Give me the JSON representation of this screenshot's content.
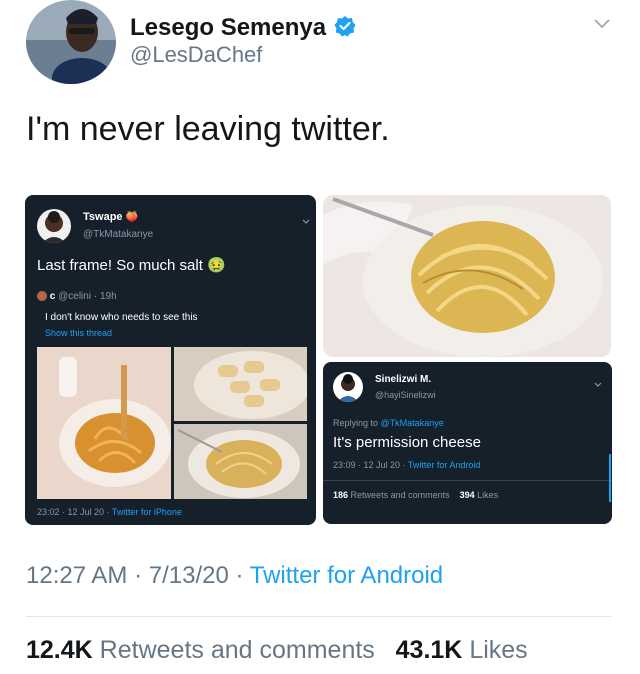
{
  "header": {
    "name": "Lesego Semenya",
    "handle": "@LesDaChef"
  },
  "tweet": {
    "text": "I'm never leaving twitter.",
    "time": "12:27 AM",
    "date": "7/13/20",
    "source": "Twitter for Android",
    "retweets": "12.4K",
    "retweets_label": "Retweets and comments",
    "likes": "43.1K",
    "likes_label": "Likes"
  },
  "quoted_left": {
    "name": "Tswape",
    "name_emoji": "🍑",
    "handle": "@TkMatakanye",
    "text": "Last frame! So much salt",
    "text_emoji": "🤢",
    "inner_name": "c",
    "inner_handle": "@celini",
    "inner_sep": "·",
    "inner_time": "19h",
    "inner_text": "I don't know who needs to see this",
    "show_thread": "Show this thread",
    "footer_time": "23:02 · 12 Jul 20 ·",
    "footer_source": "Twitter for iPhone"
  },
  "quoted_right": {
    "name": "Sinelizwi M.",
    "handle": "@hayiSinelizwi",
    "replying_prefix": "Replying to",
    "replying_to": "@TkMatakanye",
    "text": "It's permission cheese",
    "time": "23:09 · 12 Jul 20 ·",
    "source": "Twitter for Android",
    "retweets": "186",
    "retweets_label": "Retweets and comments",
    "likes": "394",
    "likes_label": "Likes"
  },
  "colors": {
    "link": "#1da1f2",
    "dark_bg": "#15202b",
    "verified": "#1da1f2"
  },
  "icons": [
    "verified-badge-icon",
    "chevron-down-icon"
  ]
}
